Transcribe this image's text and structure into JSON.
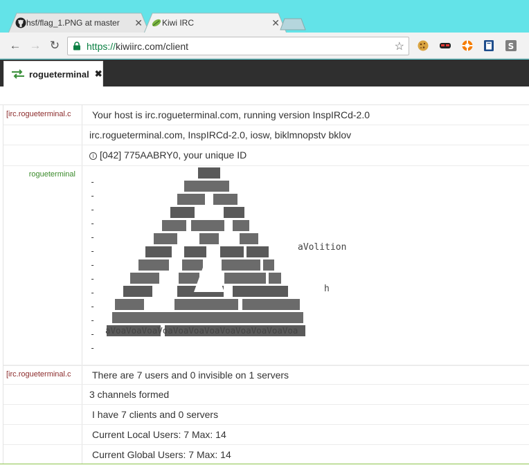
{
  "browser": {
    "tabs": [
      {
        "title": "hsf/flag_1.PNG at master",
        "icon": "github-icon"
      },
      {
        "title": "Kiwi IRC",
        "icon": "kiwi-leaf-icon"
      }
    ],
    "url_scheme": "https://",
    "url_rest": "kiwiirc.com/client",
    "extensions": [
      "cookie-icon",
      "mask-icon",
      "lifebuoy-icon",
      "book-icon",
      "stylish-icon"
    ]
  },
  "kiwi": {
    "active_tab": "rogueterminal",
    "messages": [
      {
        "nick": "[irc.rogueterminal.c",
        "text": "Your host is irc.rogueterminal.com, running version InspIRCd-2.0"
      },
      {
        "nick": "",
        "text": "irc.rogueterminal.com, InspIRCd-2.0, iosw, biklmnopstv bklov"
      },
      {
        "nick": "",
        "text": "[042] 775AABRY0, your unique ID"
      },
      {
        "nick": "[irc.rogueterminal.c",
        "text": "There are 7 users and 0 invisible on 1 servers"
      },
      {
        "nick": "",
        "text": "3 channels formed"
      },
      {
        "nick": "",
        "text": "I have 7 clients and 0 servers"
      },
      {
        "nick": "",
        "text": "Current Local Users: 7  Max: 14"
      },
      {
        "nick": "",
        "text": "Current Global Users: 7  Max: 14"
      }
    ],
    "motd": {
      "nick": "rogueterminal",
      "dash": "-",
      "side_text": "aVolition",
      "side_letter": "h",
      "footer": "aVoaVoaVoaVoaVoaVoaVoaVoaVoaVoaVoaVoa"
    }
  }
}
